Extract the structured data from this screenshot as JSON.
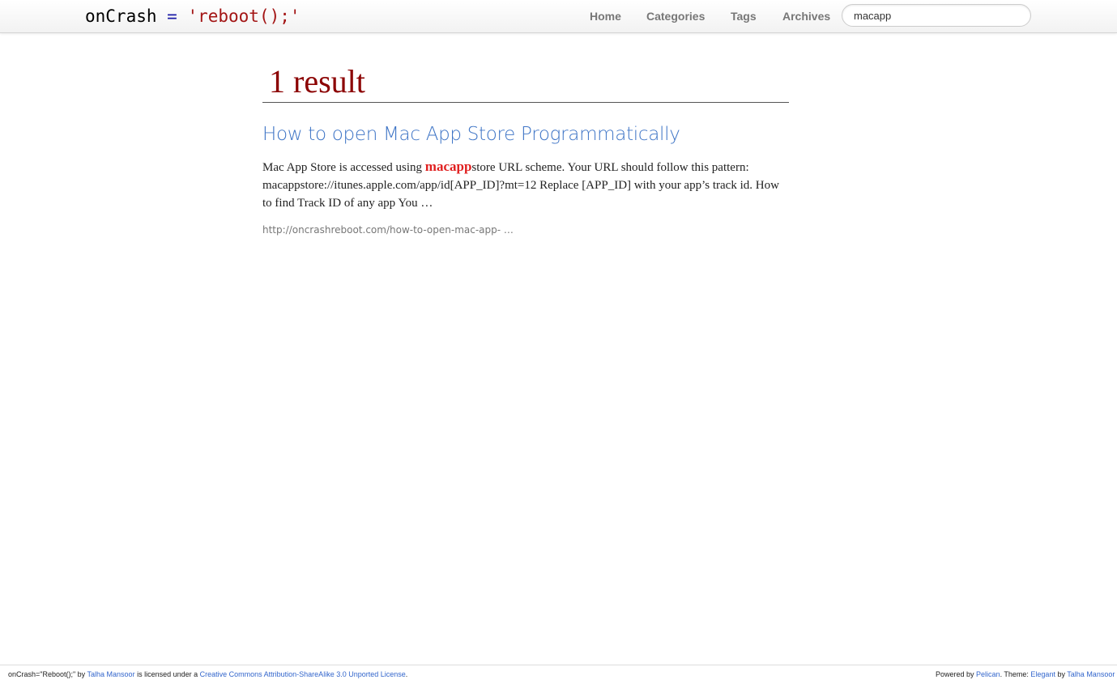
{
  "header": {
    "brand": {
      "part1": "onCrash",
      "part2": " = ",
      "part3": "'reboot();'"
    },
    "nav": [
      {
        "label": "Home"
      },
      {
        "label": "Categories"
      },
      {
        "label": "Tags"
      },
      {
        "label": "Archives"
      }
    ],
    "search": {
      "value": "macapp"
    }
  },
  "results": {
    "heading": "1 result",
    "items": [
      {
        "title": "How to open Mac App Store Programmatically",
        "snippet_pre": "Mac App Store is accessed using ",
        "snippet_highlight": "macapp",
        "snippet_post": "store URL scheme. Your URL should follow this pattern: macappstore://itunes.apple.com/app/id[APP_ID]?mt=12 Replace [APP_ID] with your app’s track id. How to find Track ID of any app You …",
        "url": "http://oncrashreboot.com/how-to-open-mac-app- …"
      }
    ]
  },
  "footer": {
    "left": {
      "t1": "onCrash=\"Reboot();\" by ",
      "author": "Talha Mansoor",
      "t2": " is licensed under a ",
      "license": "Creative Commons Attribution-ShareAlike 3.0 Unported License",
      "t3": "."
    },
    "right": {
      "t1": "Powered by ",
      "pelican": "Pelican",
      "t2": ". Theme: ",
      "theme": "Elegant",
      "t3": " by ",
      "author": "Talha Mansoor"
    }
  },
  "colors": {
    "heading": "#8b0000",
    "link": "#3f75c6",
    "highlight": "#e02020"
  }
}
